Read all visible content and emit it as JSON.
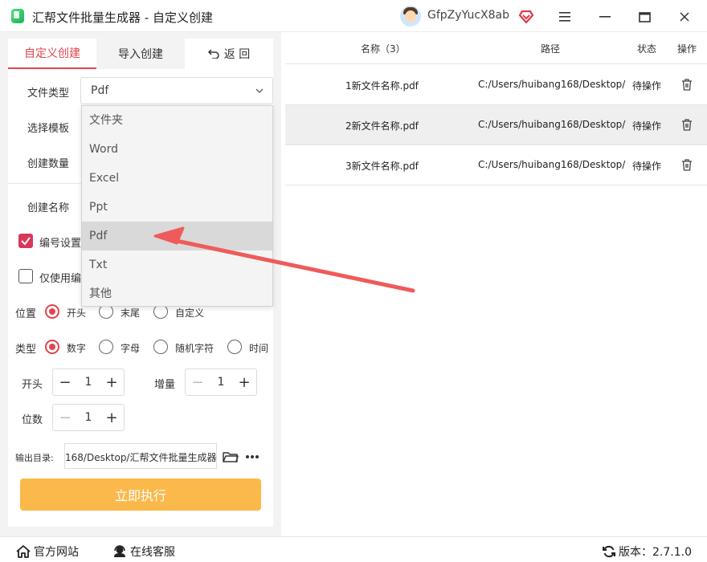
{
  "window": {
    "title": "汇帮文件批量生成器 - 自定义创建",
    "username": "GfpZyYucX8ab"
  },
  "tabs": {
    "custom": "自定义创建",
    "import": "导入创建",
    "back": "返 回"
  },
  "form": {
    "file_type_label": "文件类型",
    "file_type_value": "Pdf",
    "template_label": "选择模板",
    "count_label": "创建数量",
    "name_label": "创建名称",
    "numbering_label": "编号设置",
    "numbering_checked": true,
    "only_numbering_label": "仅使用编",
    "only_numbering_checked": false,
    "position_label": "位置",
    "position_options": [
      "开头",
      "末尾",
      "自定义"
    ],
    "position_selected": "开头",
    "type_label": "类型",
    "type_options": [
      "数字",
      "字母",
      "随机字符",
      "时间"
    ],
    "type_selected": "数字",
    "start_label": "开头",
    "start_value": "1",
    "increment_label": "增量",
    "increment_value": "1",
    "digits_label": "位数",
    "digits_value": "1",
    "output_label": "输出目录:",
    "output_value": "168/Desktop/汇帮文件批量生成器",
    "run_button": "立即执行"
  },
  "dropdown": {
    "options": [
      "文件夹",
      "Word",
      "Excel",
      "Ppt",
      "Pdf",
      "Txt",
      "其他"
    ],
    "selected": "Pdf"
  },
  "table": {
    "headers": [
      "名称（3）",
      "路径",
      "状态",
      "操作"
    ],
    "rows": [
      {
        "name": "1新文件名称.pdf",
        "path": "C:/Users/huibang168/Desktop/",
        "status": "待操作"
      },
      {
        "name": "2新文件名称.pdf",
        "path": "C:/Users/huibang168/Desktop/",
        "status": "待操作"
      },
      {
        "name": "3新文件名称.pdf",
        "path": "C:/Users/huibang168/Desktop/",
        "status": "待操作"
      }
    ]
  },
  "statusbar": {
    "website": "官方网站",
    "support": "在线客服",
    "version": "版本：2.7.1.0"
  },
  "colors": {
    "accent": "#e04650",
    "run_button": "#fbb94b",
    "arrow": "#ef5b5b"
  }
}
